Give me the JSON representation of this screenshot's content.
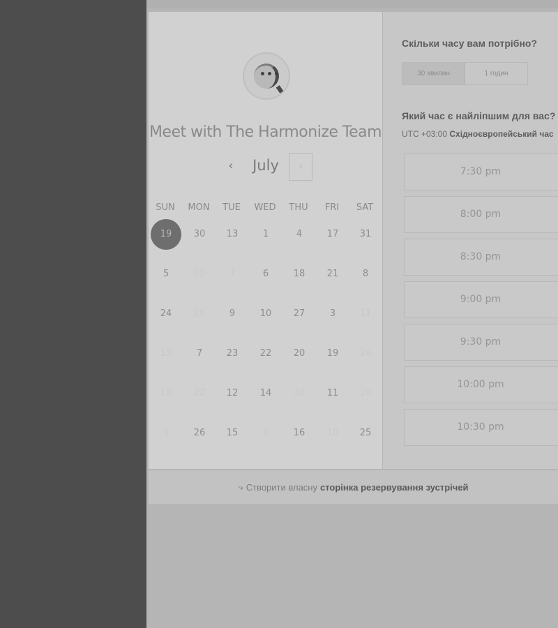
{
  "booking": {
    "title": "Meet with The Harmonize Team",
    "month": "July",
    "prev_icon": "‹",
    "next_icon": "›",
    "weekdays": [
      "SUN",
      "MON",
      "TUE",
      "WED",
      "THU",
      "FRI",
      "SAT"
    ],
    "weeks": [
      [
        {
          "d": "19",
          "s": "selected"
        },
        {
          "d": "30",
          "s": "active"
        },
        {
          "d": "13",
          "s": "active"
        },
        {
          "d": "1",
          "s": "active"
        },
        {
          "d": "4",
          "s": "active"
        },
        {
          "d": "17",
          "s": "active"
        },
        {
          "d": "31",
          "s": "active"
        }
      ],
      [
        {
          "d": "5",
          "s": "active"
        },
        {
          "d": "22",
          "s": "muted"
        },
        {
          "d": "7",
          "s": "muted"
        },
        {
          "d": "6",
          "s": "active"
        },
        {
          "d": "18",
          "s": "active"
        },
        {
          "d": "21",
          "s": "active"
        },
        {
          "d": "8",
          "s": "active"
        }
      ],
      [
        {
          "d": "24",
          "s": "active"
        },
        {
          "d": "26",
          "s": "muted"
        },
        {
          "d": "9",
          "s": "active"
        },
        {
          "d": "10",
          "s": "active"
        },
        {
          "d": "27",
          "s": "active"
        },
        {
          "d": "3",
          "s": "active"
        },
        {
          "d": "11",
          "s": "muted"
        }
      ],
      [
        {
          "d": "13",
          "s": "muted"
        },
        {
          "d": "7",
          "s": "active"
        },
        {
          "d": "23",
          "s": "active"
        },
        {
          "d": "22",
          "s": "active"
        },
        {
          "d": "20",
          "s": "active"
        },
        {
          "d": "19",
          "s": "active"
        },
        {
          "d": "26",
          "s": "muted"
        }
      ],
      [
        {
          "d": "18",
          "s": "muted"
        },
        {
          "d": "22",
          "s": "muted"
        },
        {
          "d": "12",
          "s": "active"
        },
        {
          "d": "14",
          "s": "active"
        },
        {
          "d": "30",
          "s": "muted"
        },
        {
          "d": "11",
          "s": "active"
        },
        {
          "d": "20",
          "s": "muted"
        }
      ],
      [
        {
          "d": "3",
          "s": "muted"
        },
        {
          "d": "26",
          "s": "active"
        },
        {
          "d": "15",
          "s": "active"
        },
        {
          "d": "9",
          "s": "muted"
        },
        {
          "d": "16",
          "s": "active"
        },
        {
          "d": "10",
          "s": "muted"
        },
        {
          "d": "25",
          "s": "active"
        }
      ]
    ]
  },
  "duration": {
    "heading": "Скільки часу вам потрібно?",
    "options": [
      "30 хвилин",
      "1 годин"
    ],
    "selected_index": 0
  },
  "time": {
    "heading": "Який час є найліпшим для вас?",
    "tz_offset": "UTC +03:00",
    "tz_name": "Східноєвропейський час",
    "slots": [
      "7:30 pm",
      "8:00 pm",
      "8:30 pm",
      "9:00 pm",
      "9:30 pm",
      "10:00 pm",
      "10:30 pm"
    ]
  },
  "footer": {
    "icon": "link-icon",
    "text": "Створити власну",
    "link": "сторінка резервування зустрічей"
  }
}
